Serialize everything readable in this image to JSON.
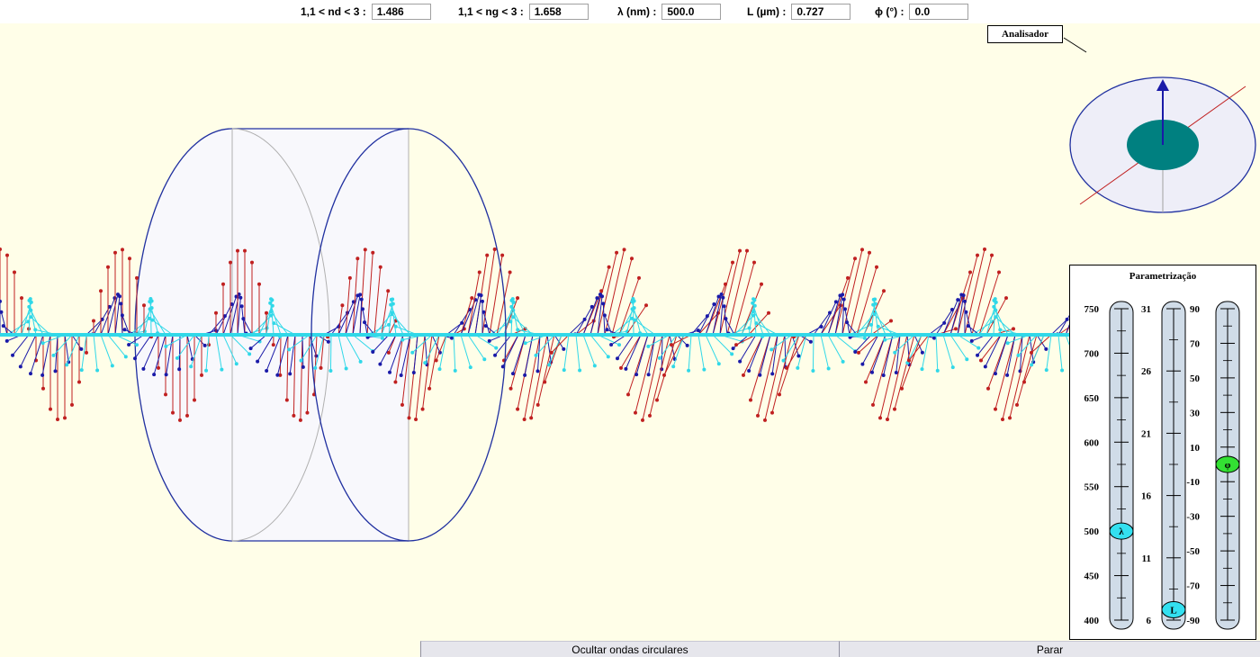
{
  "params": [
    {
      "label": "1,1 < nd < 3 :",
      "value": "1.486"
    },
    {
      "label": "1,1 < ng < 3 :",
      "value": "1.658"
    },
    {
      "label": "λ (nm) :",
      "value": "500.0"
    },
    {
      "label": "L (µm) :",
      "value": "0.727"
    },
    {
      "label": "ϕ (°) :",
      "value": "0.0"
    }
  ],
  "analyzer": {
    "label": "Analisador"
  },
  "panel": {
    "title": "Parametrização",
    "sliders": [
      {
        "name": "lambda",
        "knob": "λ",
        "ticks": [
          "750",
          "700",
          "650",
          "600",
          "550",
          "500",
          "450",
          "400"
        ],
        "range": [
          400,
          750
        ],
        "value": 500,
        "knob_color": "#33e0f0"
      },
      {
        "name": "L",
        "knob": "L",
        "ticks": [
          "31",
          "26",
          "21",
          "16",
          "11",
          "6"
        ],
        "range": [
          2,
          32
        ],
        "value": 3,
        "knob_color": "#33e0f0"
      },
      {
        "name": "phi",
        "knob": "φ",
        "ticks": [
          "90",
          "70",
          "50",
          "30",
          "10",
          "-10",
          "-30",
          "-50",
          "-70",
          "-90"
        ],
        "range": [
          -90,
          90
        ],
        "value": 0,
        "knob_color": "#33e033"
      }
    ]
  },
  "buttons": {
    "toggle_circular": "Ocultar ondas circulares",
    "stop": "Parar"
  },
  "colors": {
    "background": "#fffee8",
    "slab_outline": "#2030a0",
    "red_wave": "#c02020",
    "blue_wave": "#1a1aa8",
    "cyan_wave": "#30d8e8",
    "analyzer_disc": "#008080"
  }
}
